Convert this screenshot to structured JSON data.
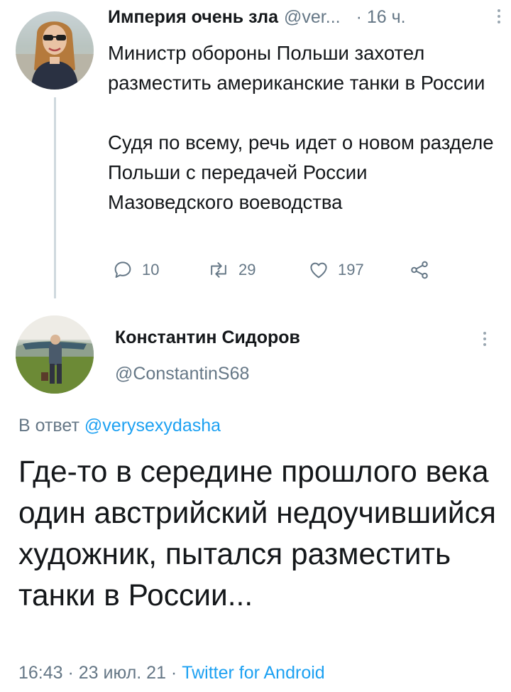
{
  "tweet1": {
    "display_name": "Империя очень зла",
    "handle": "@ver...",
    "time": "· 16 ч.",
    "body_paragraphs": [
      "Министр обороны Польши захотел разместить американские танки в России",
      "Судя по всему, речь идет о новом разделе Польши с передачей России Мазоведского воеводства"
    ],
    "counts": {
      "replies": "10",
      "retweets": "29",
      "likes": "197"
    },
    "icons": [
      "reply-icon",
      "retweet-icon",
      "like-icon",
      "share-icon",
      "more-icon"
    ]
  },
  "tweet2": {
    "display_name": "Константин Сидоров",
    "handle": "@ConstantinS68",
    "reply_prefix": "В ответ ",
    "reply_mention": "@verysexydasha",
    "body": "Где-то в середине прошлого века один австрийский недоучившийся художник, пытался разместить танки в России...",
    "timestamp": "16:43 · 23 июл. 21 · ",
    "source": "Twitter for Android"
  },
  "colors": {
    "text": "#14171a",
    "secondary": "#657786",
    "link": "#1da1f2",
    "thread_line": "#cfd9de"
  }
}
